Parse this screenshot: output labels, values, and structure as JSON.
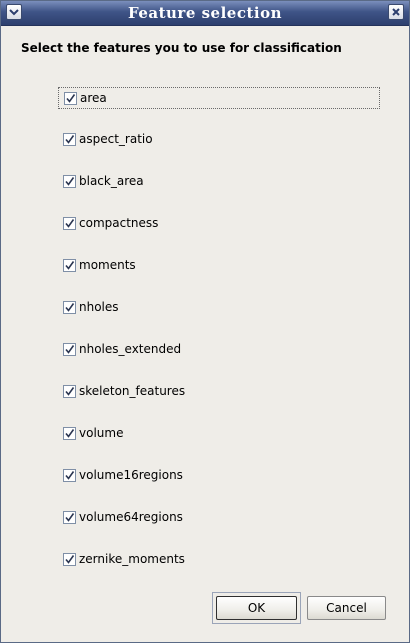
{
  "window": {
    "title": "Feature selection"
  },
  "instruction": "Select the features you to use for classification",
  "features": [
    {
      "label": "area",
      "checked": true
    },
    {
      "label": "aspect_ratio",
      "checked": true
    },
    {
      "label": "black_area",
      "checked": true
    },
    {
      "label": "compactness",
      "checked": true
    },
    {
      "label": "moments",
      "checked": true
    },
    {
      "label": "nholes",
      "checked": true
    },
    {
      "label": "nholes_extended",
      "checked": true
    },
    {
      "label": "skeleton_features",
      "checked": true
    },
    {
      "label": "volume",
      "checked": true
    },
    {
      "label": "volume16regions",
      "checked": true
    },
    {
      "label": "volume64regions",
      "checked": true
    },
    {
      "label": "zernike_moments",
      "checked": true
    }
  ],
  "buttons": {
    "ok": "OK",
    "cancel": "Cancel"
  },
  "icons": {
    "window_menu": "chevron-down-icon",
    "window_close": "close-icon",
    "check": "checkmark-icon"
  }
}
